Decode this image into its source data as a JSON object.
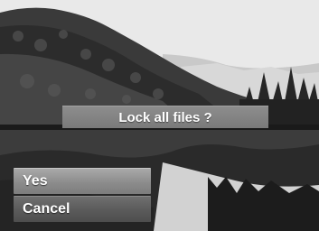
{
  "dialog": {
    "message": "Lock all files ?"
  },
  "menu": {
    "items": [
      {
        "label": "Yes",
        "selected": false
      },
      {
        "label": "Cancel",
        "selected": true
      }
    ]
  }
}
